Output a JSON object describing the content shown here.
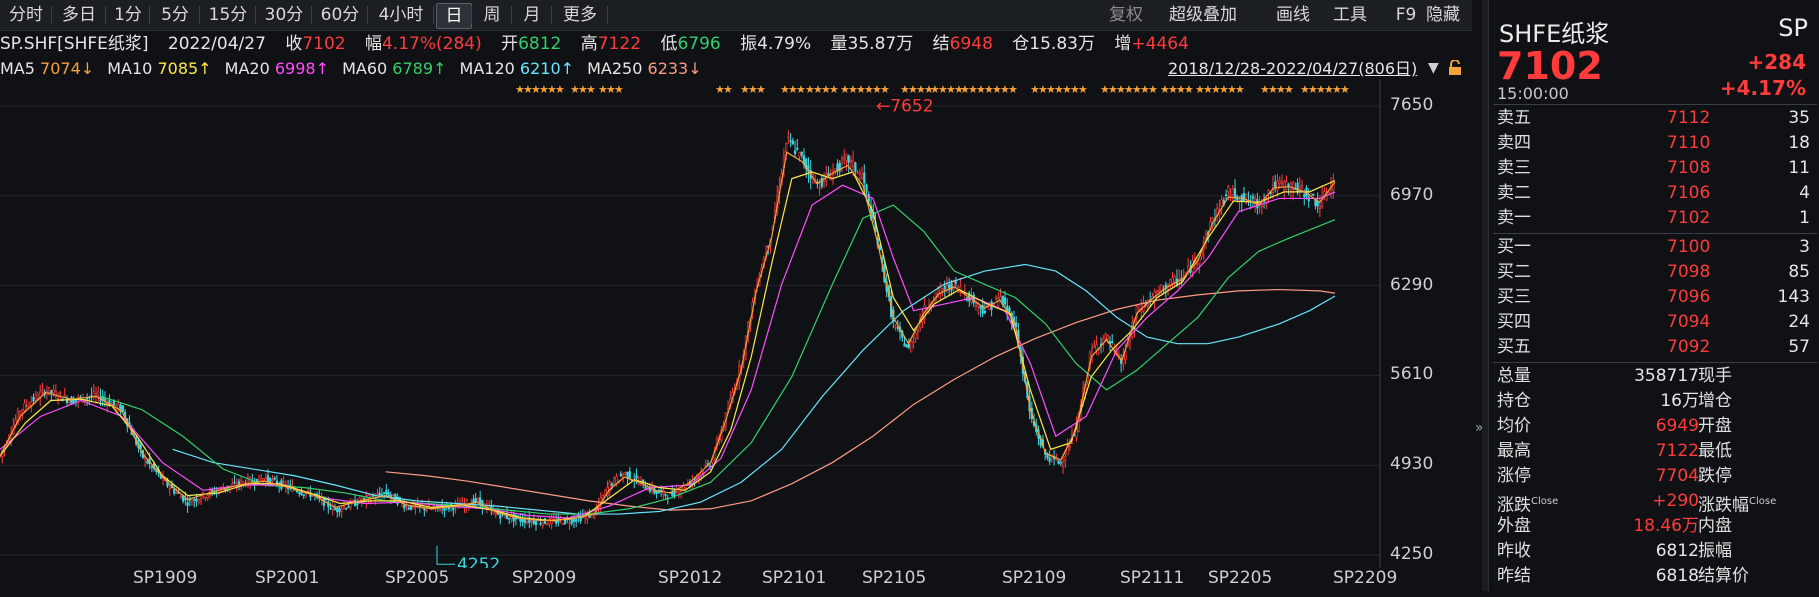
{
  "toolbar": {
    "periods": [
      "分时",
      "多日",
      "1分",
      "5分",
      "15分",
      "30分",
      "60分",
      "4小时",
      "日",
      "周",
      "月",
      "更多"
    ],
    "selected": "日",
    "tools": [
      "复权",
      "超级叠加",
      "画线",
      "工具",
      "F9",
      "隐藏"
    ]
  },
  "info": {
    "code": "SP.SHF[SHFE纸浆]",
    "date": "2022/04/27",
    "close_label": "收",
    "close": "7102",
    "amp_label": "幅",
    "amp": "4.17%(284)",
    "open_label": "开",
    "open": "6812",
    "high_label": "高",
    "high": "7122",
    "low_label": "低",
    "low": "6796",
    "swing_label": "振",
    "swing": "4.79%",
    "vol_label": "量",
    "vol": "35.87万",
    "settle_label": "结",
    "settle": "6948",
    "oi_label": "仓",
    "oi": "15.83万",
    "inc_label": "增",
    "inc": "+4464"
  },
  "ma": {
    "ma5_label": "MA5",
    "ma5": "7074↓",
    "ma10_label": "MA10",
    "ma10": "7085↑",
    "ma20_label": "MA20",
    "ma20": "6998↑",
    "ma60_label": "MA60",
    "ma60": "6789↑",
    "ma120_label": "MA120",
    "ma120": "6210↑",
    "ma250_label": "MA250",
    "ma250": "6233↓",
    "range": "2018/12/28-2022/04/27(806日)"
  },
  "chart_data": {
    "type": "candlestick",
    "y_ticks": [
      "7650",
      "6970",
      "6290",
      "5610",
      "4930",
      "4250"
    ],
    "x_ticks": [
      "SP1909",
      "SP2001",
      "SP2005",
      "SP2009",
      "SP2012",
      "SP2101",
      "SP2105",
      "SP2109",
      "SP2111",
      "SP2205",
      "SP2209"
    ],
    "high_annotation": "7652",
    "low_annotation": "4252",
    "ylim": [
      4250,
      7650
    ],
    "close_path": [
      [
        0,
        5000
      ],
      [
        20,
        5350
      ],
      [
        45,
        5500
      ],
      [
        70,
        5420
      ],
      [
        95,
        5460
      ],
      [
        120,
        5350
      ],
      [
        140,
        5000
      ],
      [
        165,
        4780
      ],
      [
        185,
        4650
      ],
      [
        210,
        4730
      ],
      [
        235,
        4790
      ],
      [
        260,
        4830
      ],
      [
        285,
        4760
      ],
      [
        310,
        4700
      ],
      [
        330,
        4590
      ],
      [
        355,
        4660
      ],
      [
        380,
        4720
      ],
      [
        400,
        4620
      ],
      [
        425,
        4600
      ],
      [
        450,
        4620
      ],
      [
        470,
        4660
      ],
      [
        490,
        4560
      ],
      [
        510,
        4520
      ],
      [
        535,
        4500
      ],
      [
        560,
        4510
      ],
      [
        585,
        4560
      ],
      [
        600,
        4780
      ],
      [
        615,
        4870
      ],
      [
        630,
        4800
      ],
      [
        645,
        4730
      ],
      [
        660,
        4700
      ],
      [
        680,
        4800
      ],
      [
        700,
        4950
      ],
      [
        715,
        5300
      ],
      [
        730,
        5700
      ],
      [
        745,
        6300
      ],
      [
        760,
        6700
      ],
      [
        775,
        7400
      ],
      [
        790,
        7250
      ],
      [
        805,
        7050
      ],
      [
        820,
        7150
      ],
      [
        835,
        7250
      ],
      [
        850,
        7100
      ],
      [
        865,
        6600
      ],
      [
        880,
        6000
      ],
      [
        895,
        5800
      ],
      [
        910,
        6100
      ],
      [
        925,
        6250
      ],
      [
        940,
        6300
      ],
      [
        955,
        6200
      ],
      [
        970,
        6100
      ],
      [
        985,
        6200
      ],
      [
        1000,
        6000
      ],
      [
        1015,
        5300
      ],
      [
        1030,
        5000
      ],
      [
        1045,
        4950
      ],
      [
        1060,
        5200
      ],
      [
        1075,
        5800
      ],
      [
        1090,
        5900
      ],
      [
        1105,
        5700
      ],
      [
        1120,
        6100
      ],
      [
        1135,
        6200
      ],
      [
        1150,
        6300
      ],
      [
        1165,
        6350
      ],
      [
        1180,
        6500
      ],
      [
        1195,
        6800
      ],
      [
        1210,
        7000
      ],
      [
        1225,
        6950
      ],
      [
        1240,
        6900
      ],
      [
        1255,
        7050
      ],
      [
        1270,
        7050
      ],
      [
        1285,
        7000
      ],
      [
        1300,
        6900
      ],
      [
        1315,
        7102
      ]
    ],
    "ma5": [
      [
        0,
        5000
      ],
      [
        20,
        5300
      ],
      [
        45,
        5480
      ],
      [
        70,
        5430
      ],
      [
        95,
        5450
      ],
      [
        120,
        5340
      ],
      [
        140,
        5020
      ],
      [
        165,
        4800
      ],
      [
        185,
        4670
      ],
      [
        210,
        4730
      ],
      [
        235,
        4780
      ],
      [
        260,
        4810
      ],
      [
        285,
        4760
      ],
      [
        310,
        4700
      ],
      [
        330,
        4610
      ],
      [
        355,
        4660
      ],
      [
        380,
        4700
      ],
      [
        400,
        4630
      ],
      [
        425,
        4600
      ],
      [
        450,
        4620
      ],
      [
        470,
        4650
      ],
      [
        490,
        4570
      ],
      [
        510,
        4530
      ],
      [
        535,
        4510
      ],
      [
        560,
        4520
      ],
      [
        585,
        4560
      ],
      [
        600,
        4740
      ],
      [
        615,
        4840
      ],
      [
        630,
        4800
      ],
      [
        645,
        4740
      ],
      [
        660,
        4720
      ],
      [
        680,
        4800
      ],
      [
        700,
        4950
      ],
      [
        715,
        5270
      ],
      [
        730,
        5650
      ],
      [
        745,
        6250
      ],
      [
        760,
        6650
      ],
      [
        775,
        7300
      ],
      [
        790,
        7230
      ],
      [
        805,
        7060
      ],
      [
        820,
        7140
      ],
      [
        835,
        7200
      ],
      [
        850,
        7050
      ],
      [
        865,
        6600
      ],
      [
        880,
        6050
      ],
      [
        895,
        5850
      ],
      [
        910,
        6080
      ],
      [
        925,
        6230
      ],
      [
        940,
        6280
      ],
      [
        955,
        6200
      ],
      [
        970,
        6120
      ],
      [
        985,
        6180
      ],
      [
        1000,
        6000
      ],
      [
        1015,
        5350
      ],
      [
        1030,
        5020
      ],
      [
        1045,
        4970
      ],
      [
        1060,
        5200
      ],
      [
        1075,
        5750
      ],
      [
        1090,
        5880
      ],
      [
        1105,
        5720
      ],
      [
        1120,
        6080
      ],
      [
        1135,
        6190
      ],
      [
        1150,
        6280
      ],
      [
        1165,
        6340
      ],
      [
        1180,
        6480
      ],
      [
        1195,
        6770
      ],
      [
        1210,
        6960
      ],
      [
        1225,
        6950
      ],
      [
        1240,
        6900
      ],
      [
        1255,
        7030
      ],
      [
        1270,
        7040
      ],
      [
        1285,
        7000
      ],
      [
        1300,
        6920
      ],
      [
        1315,
        7074
      ]
    ],
    "ma10": [
      [
        0,
        5000
      ],
      [
        25,
        5250
      ],
      [
        50,
        5420
      ],
      [
        80,
        5430
      ],
      [
        110,
        5380
      ],
      [
        135,
        5150
      ],
      [
        160,
        4850
      ],
      [
        185,
        4700
      ],
      [
        215,
        4720
      ],
      [
        245,
        4790
      ],
      [
        275,
        4790
      ],
      [
        305,
        4720
      ],
      [
        335,
        4640
      ],
      [
        365,
        4660
      ],
      [
        395,
        4660
      ],
      [
        425,
        4610
      ],
      [
        455,
        4630
      ],
      [
        485,
        4590
      ],
      [
        515,
        4530
      ],
      [
        545,
        4510
      ],
      [
        575,
        4540
      ],
      [
        600,
        4680
      ],
      [
        625,
        4820
      ],
      [
        650,
        4760
      ],
      [
        675,
        4740
      ],
      [
        700,
        4880
      ],
      [
        720,
        5200
      ],
      [
        740,
        5750
      ],
      [
        760,
        6450
      ],
      [
        780,
        7100
      ],
      [
        800,
        7150
      ],
      [
        820,
        7100
      ],
      [
        840,
        7150
      ],
      [
        860,
        6850
      ],
      [
        880,
        6200
      ],
      [
        900,
        5950
      ],
      [
        920,
        6150
      ],
      [
        945,
        6260
      ],
      [
        970,
        6160
      ],
      [
        995,
        6080
      ],
      [
        1015,
        5500
      ],
      [
        1035,
        5050
      ],
      [
        1055,
        5100
      ],
      [
        1075,
        5600
      ],
      [
        1095,
        5800
      ],
      [
        1115,
        5950
      ],
      [
        1140,
        6200
      ],
      [
        1165,
        6320
      ],
      [
        1190,
        6650
      ],
      [
        1215,
        6930
      ],
      [
        1240,
        6920
      ],
      [
        1265,
        7000
      ],
      [
        1290,
        7000
      ],
      [
        1315,
        7085
      ]
    ],
    "ma20": [
      [
        0,
        5050
      ],
      [
        40,
        5300
      ],
      [
        80,
        5420
      ],
      [
        120,
        5300
      ],
      [
        160,
        4950
      ],
      [
        200,
        4740
      ],
      [
        240,
        4780
      ],
      [
        280,
        4780
      ],
      [
        320,
        4680
      ],
      [
        360,
        4640
      ],
      [
        400,
        4650
      ],
      [
        440,
        4620
      ],
      [
        480,
        4600
      ],
      [
        520,
        4550
      ],
      [
        560,
        4530
      ],
      [
        600,
        4620
      ],
      [
        640,
        4760
      ],
      [
        680,
        4780
      ],
      [
        710,
        4980
      ],
      [
        740,
        5500
      ],
      [
        770,
        6300
      ],
      [
        800,
        6900
      ],
      [
        830,
        7050
      ],
      [
        860,
        6950
      ],
      [
        880,
        6500
      ],
      [
        900,
        6100
      ],
      [
        930,
        6150
      ],
      [
        960,
        6200
      ],
      [
        990,
        6100
      ],
      [
        1015,
        5700
      ],
      [
        1040,
        5150
      ],
      [
        1070,
        5300
      ],
      [
        1100,
        5800
      ],
      [
        1130,
        6050
      ],
      [
        1160,
        6250
      ],
      [
        1190,
        6500
      ],
      [
        1220,
        6850
      ],
      [
        1260,
        6950
      ],
      [
        1300,
        6950
      ],
      [
        1315,
        6998
      ]
    ],
    "ma60": [
      [
        100,
        5450
      ],
      [
        140,
        5350
      ],
      [
        180,
        5150
      ],
      [
        220,
        4900
      ],
      [
        260,
        4780
      ],
      [
        300,
        4760
      ],
      [
        340,
        4720
      ],
      [
        380,
        4660
      ],
      [
        420,
        4640
      ],
      [
        460,
        4620
      ],
      [
        500,
        4590
      ],
      [
        540,
        4560
      ],
      [
        580,
        4560
      ],
      [
        620,
        4600
      ],
      [
        660,
        4680
      ],
      [
        700,
        4800
      ],
      [
        740,
        5100
      ],
      [
        780,
        5600
      ],
      [
        820,
        6300
      ],
      [
        850,
        6800
      ],
      [
        880,
        6900
      ],
      [
        910,
        6700
      ],
      [
        940,
        6400
      ],
      [
        970,
        6300
      ],
      [
        1000,
        6200
      ],
      [
        1030,
        6000
      ],
      [
        1060,
        5700
      ],
      [
        1090,
        5500
      ],
      [
        1120,
        5650
      ],
      [
        1150,
        5850
      ],
      [
        1180,
        6050
      ],
      [
        1210,
        6350
      ],
      [
        1240,
        6550
      ],
      [
        1270,
        6650
      ],
      [
        1315,
        6789
      ]
    ],
    "ma120": [
      [
        170,
        5050
      ],
      [
        210,
        4950
      ],
      [
        250,
        4900
      ],
      [
        290,
        4850
      ],
      [
        330,
        4780
      ],
      [
        370,
        4700
      ],
      [
        410,
        4660
      ],
      [
        450,
        4640
      ],
      [
        490,
        4620
      ],
      [
        530,
        4590
      ],
      [
        570,
        4560
      ],
      [
        610,
        4560
      ],
      [
        650,
        4580
      ],
      [
        690,
        4650
      ],
      [
        730,
        4800
      ],
      [
        770,
        5050
      ],
      [
        810,
        5450
      ],
      [
        850,
        5800
      ],
      [
        890,
        6100
      ],
      [
        930,
        6300
      ],
      [
        970,
        6400
      ],
      [
        1010,
        6450
      ],
      [
        1040,
        6400
      ],
      [
        1070,
        6250
      ],
      [
        1100,
        6050
      ],
      [
        1130,
        5900
      ],
      [
        1160,
        5850
      ],
      [
        1190,
        5850
      ],
      [
        1220,
        5900
      ],
      [
        1260,
        6000
      ],
      [
        1290,
        6100
      ],
      [
        1315,
        6210
      ]
    ],
    "ma250": [
      [
        380,
        4880
      ],
      [
        420,
        4850
      ],
      [
        460,
        4810
      ],
      [
        500,
        4760
      ],
      [
        540,
        4710
      ],
      [
        580,
        4660
      ],
      [
        620,
        4620
      ],
      [
        660,
        4590
      ],
      [
        700,
        4600
      ],
      [
        740,
        4660
      ],
      [
        780,
        4790
      ],
      [
        820,
        4950
      ],
      [
        860,
        5150
      ],
      [
        900,
        5390
      ],
      [
        940,
        5580
      ],
      [
        980,
        5750
      ],
      [
        1020,
        5890
      ],
      [
        1060,
        6010
      ],
      [
        1100,
        6110
      ],
      [
        1140,
        6180
      ],
      [
        1180,
        6220
      ],
      [
        1220,
        6250
      ],
      [
        1260,
        6260
      ],
      [
        1300,
        6250
      ],
      [
        1315,
        6233
      ]
    ]
  },
  "panel": {
    "name": "SHFE纸浆",
    "code": "SP",
    "price": "7102",
    "change": "+284",
    "pct": "+4.17%",
    "time": "15:00:00",
    "asks": [
      {
        "label": "卖五",
        "price": "7112",
        "vol": "35"
      },
      {
        "label": "卖四",
        "price": "7110",
        "vol": "18"
      },
      {
        "label": "卖三",
        "price": "7108",
        "vol": "11"
      },
      {
        "label": "卖二",
        "price": "7106",
        "vol": "4"
      },
      {
        "label": "卖一",
        "price": "7102",
        "vol": "1"
      }
    ],
    "bids": [
      {
        "label": "买一",
        "price": "7100",
        "vol": "3"
      },
      {
        "label": "买二",
        "price": "7098",
        "vol": "85"
      },
      {
        "label": "买三",
        "price": "7096",
        "vol": "143"
      },
      {
        "label": "买四",
        "price": "7094",
        "vol": "24"
      },
      {
        "label": "买五",
        "price": "7092",
        "vol": "57"
      }
    ],
    "stats": [
      {
        "l": "总量",
        "v": "358717",
        "r": "现手",
        "color": "#e6e6e6"
      },
      {
        "l": "持仓",
        "v": "16万",
        "r": "增仓",
        "color": "#e6e6e6"
      },
      {
        "l": "均价",
        "v": "6949",
        "r": "开盘",
        "color": "#ff3b3b"
      },
      {
        "l": "最高",
        "v": "7122",
        "r": "最低",
        "color": "#ff3b3b"
      },
      {
        "l": "涨停",
        "v": "7704",
        "r": "跌停",
        "color": "#ff3b3b"
      },
      {
        "l": "涨跌",
        "v": "+290",
        "r": "涨跌幅",
        "color": "#ff3b3b",
        "sup": "Close",
        "rsup": "Close"
      },
      {
        "l": "外盘",
        "v": "18.46万",
        "r": "内盘",
        "color": "#ff3b3b"
      },
      {
        "l": "昨收",
        "v": "6812",
        "r": "振幅",
        "color": "#e6e6e6"
      },
      {
        "l": "昨结",
        "v": "6818",
        "r": "结算价",
        "color": "#e6e6e6"
      }
    ]
  }
}
